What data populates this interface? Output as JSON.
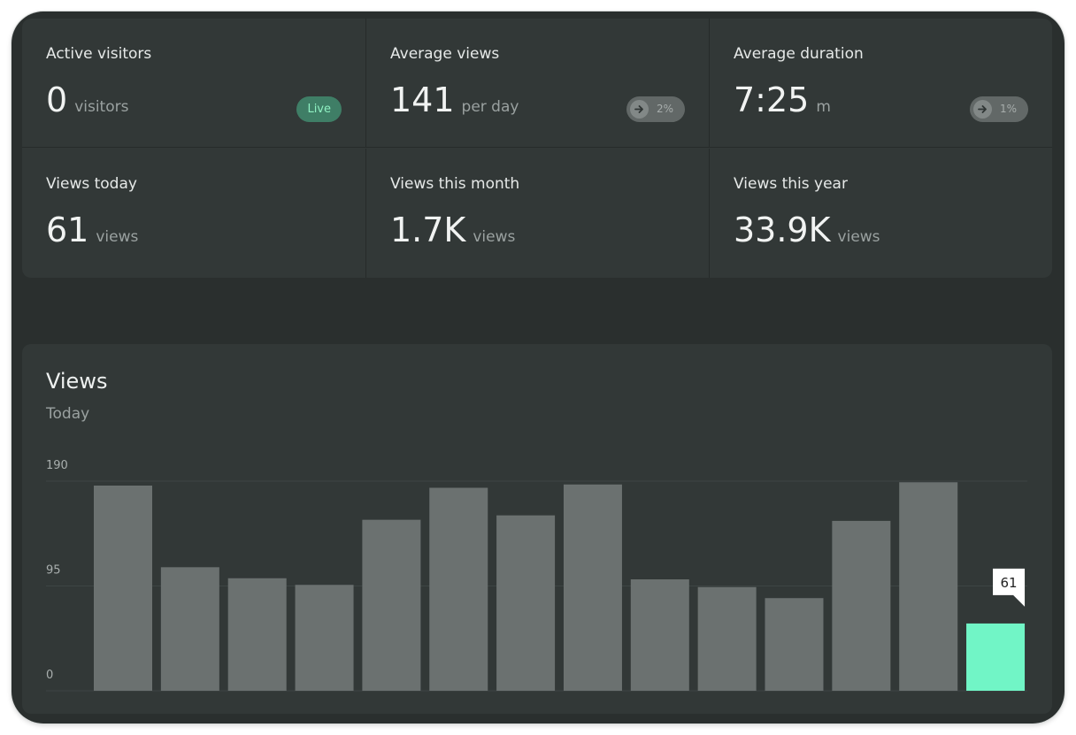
{
  "stats": [
    {
      "label": "Active visitors",
      "value": "0",
      "unit": "visitors",
      "badge": {
        "type": "live",
        "text": "Live"
      }
    },
    {
      "label": "Average views",
      "value": "141",
      "unit": "per day",
      "badge": {
        "type": "trend",
        "text": "2%",
        "icon": "arrow-right-icon"
      }
    },
    {
      "label": "Average duration",
      "value": "7:25",
      "unit": "m",
      "badge": {
        "type": "trend",
        "text": "1%",
        "icon": "arrow-right-icon"
      }
    },
    {
      "label": "Views today",
      "value": "61",
      "unit": "views"
    },
    {
      "label": "Views this month",
      "value": "1.7K",
      "unit": "views"
    },
    {
      "label": "Views this year",
      "value": "33.9K",
      "unit": "views"
    }
  ],
  "chart": {
    "title": "Views",
    "subtitle": "Today"
  },
  "chart_data": {
    "type": "bar",
    "ylim": [
      0,
      190
    ],
    "yticks": [
      190,
      95,
      0
    ],
    "values": [
      186,
      112,
      102,
      96,
      155,
      184,
      159,
      187,
      101,
      94,
      84,
      154,
      189,
      61
    ],
    "highlight_index": 13,
    "tooltip": "61",
    "colors": {
      "bar": "#6b7170",
      "highlight": "#71f5c6",
      "grid": "#3e4544",
      "tick": "#a9afae"
    }
  },
  "colors": {
    "frame": "#2a2f2e",
    "card": "#323837",
    "live_badge_bg": "#3f7e66",
    "live_badge_text": "#8ff0c2"
  }
}
